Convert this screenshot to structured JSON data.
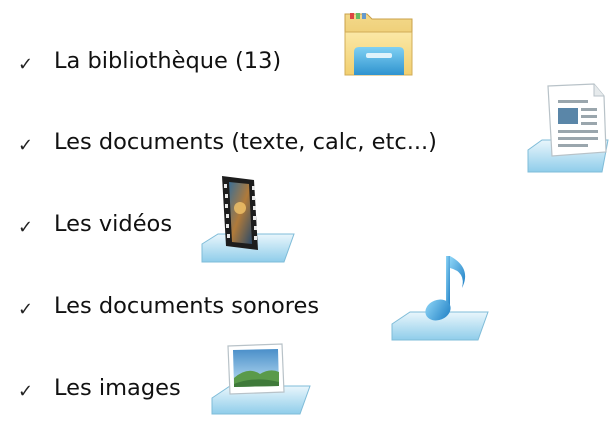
{
  "items": [
    {
      "label": "La bibliothèque (13)",
      "icon": "library-folder-icon"
    },
    {
      "label": "Les documents (texte, calc, etc...)",
      "icon": "document-library-icon"
    },
    {
      "label": "Les vidéos",
      "icon": "video-library-icon"
    },
    {
      "label": "Les documents sonores",
      "icon": "music-library-icon"
    },
    {
      "label": "Les images",
      "icon": "picture-library-icon"
    }
  ],
  "check_glyph": "✓"
}
